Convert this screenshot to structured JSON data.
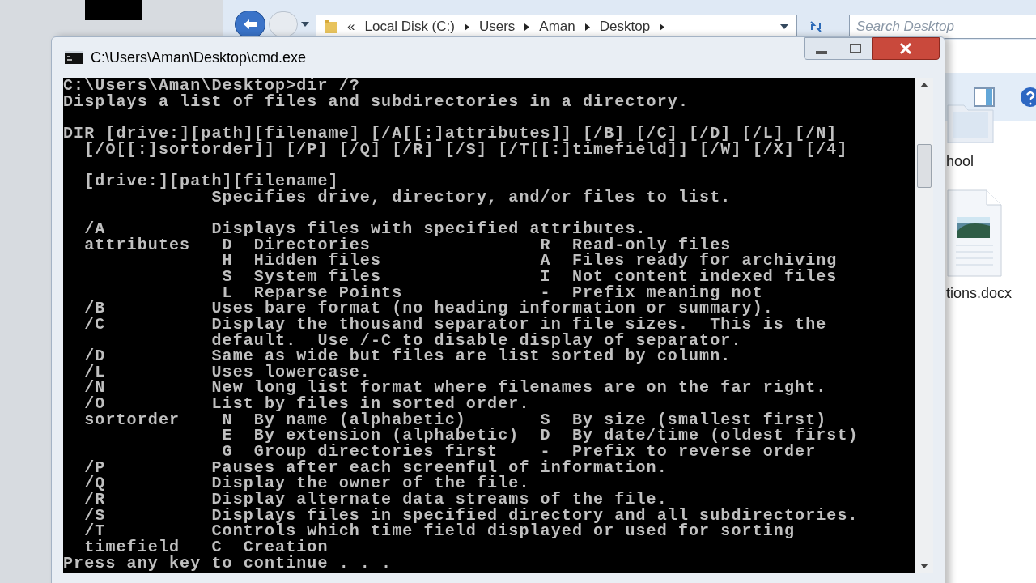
{
  "explorer": {
    "address": [
      "«",
      "Local Disk (C:)",
      "Users",
      "Aman",
      "Desktop"
    ],
    "search": {
      "placeholder": "Search Desktop"
    },
    "files": [
      {
        "kind": "folder",
        "name": "hool"
      },
      {
        "kind": "document",
        "name": "tions.docx"
      }
    ]
  },
  "console": {
    "title": "C:\\Users\\Aman\\Desktop\\cmd.exe",
    "lines": [
      {
        "kind": "text",
        "text": "C:\\Users\\Aman\\Desktop>dir /?"
      },
      {
        "kind": "text",
        "text": "Displays a list of files and subdirectories in a directory."
      },
      {
        "kind": "blank"
      },
      {
        "kind": "text",
        "text": "DIR [drive:][path][filename] [/A[[:]attributes]] [/B] [/C] [/D] [/L] [/N]"
      },
      {
        "kind": "text",
        "text": "  [/O[[:]sortorder]] [/P] [/Q] [/R] [/S] [/T[[:]timefield]] [/W] [/X] [/4]"
      },
      {
        "kind": "blank"
      },
      {
        "kind": "text",
        "text": "  [drive:][path][filename]"
      },
      {
        "kind": "text",
        "text": "              Specifies drive, directory, and/or files to list."
      },
      {
        "kind": "blank"
      },
      {
        "kind": "text",
        "text": "  /A          Displays files with specified attributes."
      },
      {
        "kind": "text",
        "text": "  attributes   D  Directories                R  Read-only files"
      },
      {
        "kind": "text",
        "text": "               H  Hidden files               A  Files ready for archiving"
      },
      {
        "kind": "text",
        "text": "               S  System files               I  Not content indexed files"
      },
      {
        "kind": "text",
        "text": "               L  Reparse Points             -  Prefix meaning not"
      },
      {
        "kind": "text",
        "text": "  /B          Uses bare format (no heading information or summary)."
      },
      {
        "kind": "text",
        "text": "  /C          Display the thousand separator in file sizes.  This is the"
      },
      {
        "kind": "text",
        "text": "              default.  Use /-C to disable display of separator."
      },
      {
        "kind": "text",
        "text": "  /D          Same as wide but files are list sorted by column."
      },
      {
        "kind": "text",
        "text": "  /L          Uses lowercase."
      },
      {
        "kind": "text",
        "text": "  /N          New long list format where filenames are on the far right."
      },
      {
        "kind": "text",
        "text": "  /O          List by files in sorted order."
      },
      {
        "kind": "text",
        "text": "  sortorder    N  By name (alphabetic)       S  By size (smallest first)"
      },
      {
        "kind": "text",
        "text": "               E  By extension (alphabetic)  D  By date/time (oldest first)"
      },
      {
        "kind": "text",
        "text": "               G  Group directories first    -  Prefix to reverse order"
      },
      {
        "kind": "text",
        "text": "  /P          Pauses after each screenful of information."
      },
      {
        "kind": "text",
        "text": "  /Q          Display the owner of the file."
      },
      {
        "kind": "text",
        "text": "  /R          Display alternate data streams of the file."
      },
      {
        "kind": "text",
        "text": "  /S          Displays files in specified directory and all subdirectories."
      },
      {
        "kind": "text",
        "text": "  /T          Controls which time field displayed or used for sorting"
      },
      {
        "kind": "text",
        "text": "  timefield   C  Creation"
      },
      {
        "kind": "text",
        "text": "Press any key to continue . . ."
      }
    ]
  }
}
